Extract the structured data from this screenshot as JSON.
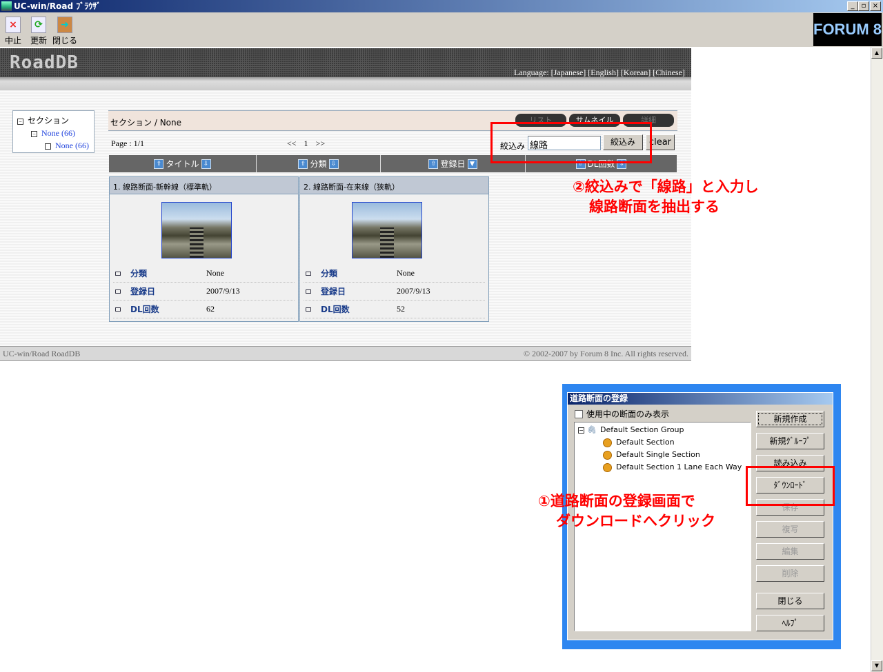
{
  "window": {
    "title": "UC-win/Road ﾌﾞﾗｳｻﾞ",
    "min": "_",
    "max": "▫",
    "close": "×"
  },
  "toolbar": {
    "stop": "中止",
    "refresh": "更新",
    "close": "閉じる",
    "brand": "FORUM 8"
  },
  "site": {
    "logo": "RoadDB",
    "language": "Language: [Japanese] [English] [Korean] [Chinese]",
    "footer_left": "UC-win/Road RoadDB",
    "footer_right": "© 2002-2007 by Forum 8 Inc. All rights reserved."
  },
  "tree": {
    "root": "セクション",
    "child": "None (66)",
    "grandchild": "None (66)"
  },
  "section": {
    "breadcrumb_root": "セクション",
    "breadcrumb_sep": " / ",
    "breadcrumb_current": "None",
    "tabs": [
      "リスト",
      "サムネイル",
      "詳細"
    ],
    "page_info": "Page : 1/1",
    "pager_prev": "<<",
    "pager_page": "1",
    "pager_next": ">>"
  },
  "filter": {
    "label": "絞込み",
    "value": "線路",
    "button": "絞込み",
    "clear": "clear"
  },
  "columns": [
    "タイトル",
    "分類",
    "登録日",
    "DL回数"
  ],
  "items": [
    {
      "title": "1. 線路断面-新幹線（標準軌）",
      "category_label": "分類",
      "category": "None",
      "date_label": "登録日",
      "date": "2007/9/13",
      "dl_label": "DL回数",
      "dl": "62"
    },
    {
      "title": "2. 線路断面-在来線（狭軌）",
      "category_label": "分類",
      "category": "None",
      "date_label": "登録日",
      "date": "2007/9/13",
      "dl_label": "DL回数",
      "dl": "52"
    }
  ],
  "annotations": {
    "note2_line1": "②絞込みで「線路」と入力し",
    "note2_line2": "線路断面を抽出する",
    "note1_line1": "①道路断面の登録画面で",
    "note1_line2": "ダウンロードへクリック"
  },
  "dialog": {
    "title": "道路断面の登録",
    "checkbox": "使用中の断面のみ表示",
    "group": "Default Section Group",
    "sections": [
      "Default Section",
      "Default Single Section",
      "Default Section 1 Lane Each Way"
    ],
    "buttons": {
      "new": "新規作成",
      "new_group": "新規ｸﾞﾙｰﾌﾟ",
      "load": "読み込み",
      "download": "ﾀﾞｳﾝﾛｰﾄﾞ",
      "save": "保存",
      "copy": "複写",
      "edit": "編集",
      "delete": "削除",
      "close": "閉じる",
      "help": "ﾍﾙﾌﾟ"
    }
  },
  "colors": {
    "annotation": "#ff0000",
    "dialog_frame": "#2e86f0"
  }
}
